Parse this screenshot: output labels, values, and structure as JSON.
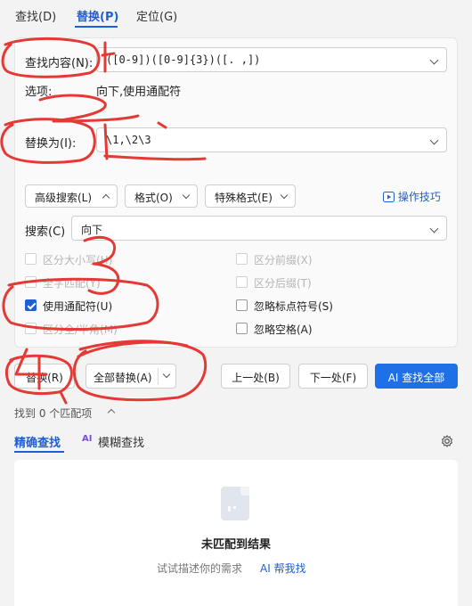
{
  "tabs": [
    {
      "label": "查找(D)"
    },
    {
      "label": "替换(P)"
    },
    {
      "label": "定位(G)"
    }
  ],
  "find": {
    "label": "查找内容(N):",
    "value": "([0-9])([0-9]{3})([. ,])"
  },
  "options": {
    "label": "选项:",
    "value": "向下,使用通配符"
  },
  "replace": {
    "label": "替换为(I):",
    "value": "\\1,\\2\\3"
  },
  "toolbar": {
    "advanced_search": "高级搜索(L)",
    "format": "格式(O)",
    "special": "特殊格式(E)",
    "tips": "操作技巧"
  },
  "search_direction": {
    "label": "搜索(C)",
    "value": "向下"
  },
  "checkboxes": {
    "left": [
      {
        "label": "区分大小写(H)",
        "checked": false,
        "enabled": false
      },
      {
        "label": "全字匹配(Y)",
        "checked": false,
        "enabled": false
      },
      {
        "label": "使用通配符(U)",
        "checked": true,
        "enabled": true
      },
      {
        "label": "区分全/半角(M)",
        "checked": false,
        "enabled": false
      }
    ],
    "right": [
      {
        "label": "区分前缀(X)",
        "checked": false,
        "enabled": false
      },
      {
        "label": "区分后缀(T)",
        "checked": false,
        "enabled": false
      },
      {
        "label": "忽略标点符号(S)",
        "checked": false,
        "enabled": true
      },
      {
        "label": "忽略空格(A)",
        "checked": false,
        "enabled": true
      }
    ]
  },
  "buttons": {
    "replace": "替换(R)",
    "replace_all": "全部替换(A)",
    "prev": "上一处(B)",
    "next": "下一处(F)",
    "ai_find_all": "AI 查找全部"
  },
  "match_count": "找到 0 个匹配项",
  "search_mode": {
    "exact": "精确查找",
    "fuzzy_badge": "AI",
    "fuzzy": "模糊查找"
  },
  "empty": {
    "title": "未匹配到结果",
    "hint": "试试描述你的需求",
    "ai_link": "AI 帮我找"
  },
  "colors": {
    "accent": "#1f5fd4",
    "annotation": "#e53935"
  }
}
